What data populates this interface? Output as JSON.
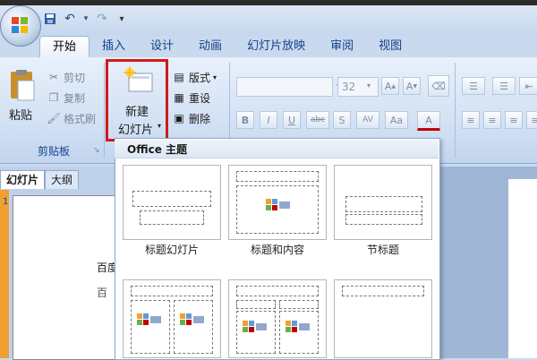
{
  "quick_access": {
    "save_icon": "save-icon",
    "undo_icon": "undo-icon",
    "redo_icon": "redo-icon"
  },
  "ribbon_tabs": [
    {
      "label": "开始",
      "active": true
    },
    {
      "label": "插入"
    },
    {
      "label": "设计"
    },
    {
      "label": "动画"
    },
    {
      "label": "幻灯片放映"
    },
    {
      "label": "审阅"
    },
    {
      "label": "视图"
    }
  ],
  "clipboard": {
    "paste_label": "粘贴",
    "cut_label": "剪切",
    "copy_label": "复制",
    "format_painter_label": "格式刷",
    "group_label": "剪贴板"
  },
  "slides_group": {
    "new_slide_line1": "新建",
    "new_slide_line2": "幻灯片",
    "layout_label": "版式",
    "reset_label": "重设",
    "delete_label": "删除"
  },
  "font_group": {
    "font_size": "32",
    "bold": "B",
    "italic": "I",
    "underline": "U",
    "strike": "abc",
    "shadow": "S",
    "spacing": "AV",
    "case": "Aa",
    "color": "A"
  },
  "panel_tabs": {
    "slides": "幻灯片",
    "outline": "大纲"
  },
  "slide_thumb": {
    "number": "1",
    "text": "百度",
    "text2": "百"
  },
  "gallery": {
    "title": "Office 主题",
    "layouts": [
      "标题幻灯片",
      "标题和内容",
      "节标题"
    ]
  }
}
